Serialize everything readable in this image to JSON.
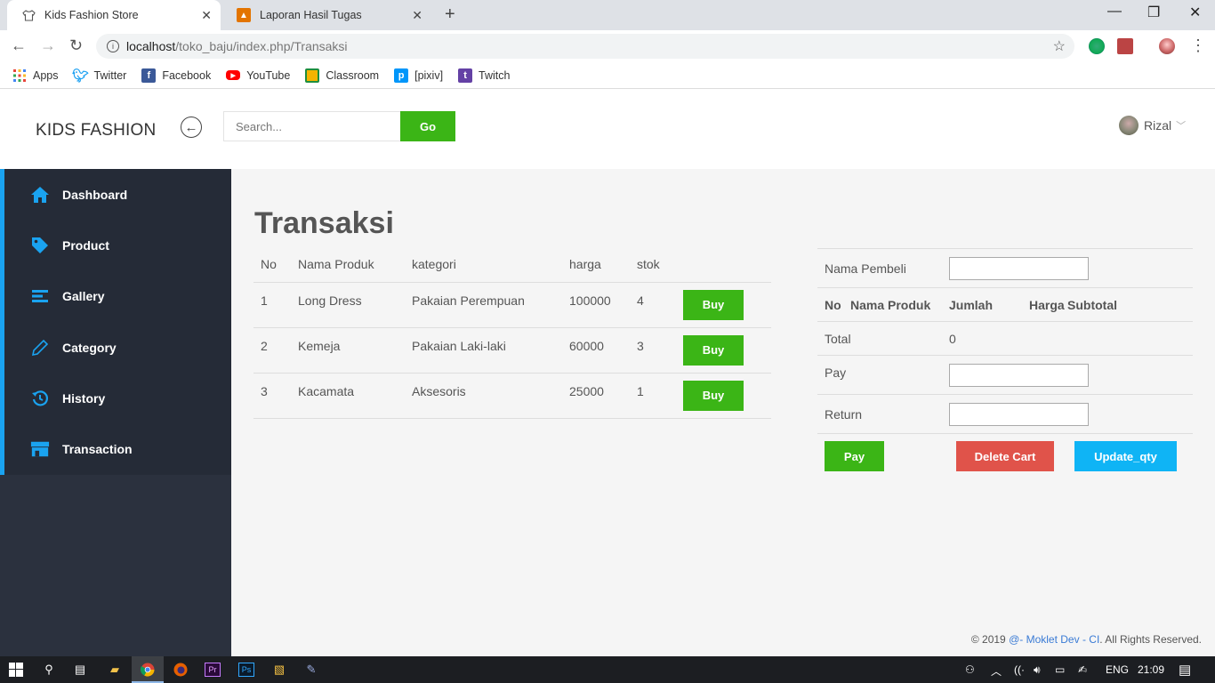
{
  "browser": {
    "tabs": [
      {
        "title": "Kids Fashion Store",
        "active": true
      },
      {
        "title": "Laporan Hasil Tugas",
        "active": false
      }
    ],
    "url_host": "localhost",
    "url_path": "/toko_baju/index.php/Transaksi",
    "bookmarks": [
      {
        "label": "Apps",
        "icon": "apps-grid-icon",
        "color": "#e8453c"
      },
      {
        "label": "Twitter",
        "icon": "twitter-icon",
        "color": "#1da1f2"
      },
      {
        "label": "Facebook",
        "icon": "facebook-icon",
        "color": "#3b5998"
      },
      {
        "label": "YouTube",
        "icon": "youtube-icon",
        "color": "#ff0000"
      },
      {
        "label": "Classroom",
        "icon": "classroom-icon",
        "color": "#f4b400"
      },
      {
        "label": "[pixiv]",
        "icon": "pixiv-icon",
        "color": "#0096fa"
      },
      {
        "label": "Twitch",
        "icon": "twitch-icon",
        "color": "#6441a5"
      }
    ]
  },
  "header": {
    "brand": "KIDS FASHION",
    "search_placeholder": "Search...",
    "go_label": "Go",
    "user_name": "Rizal"
  },
  "sidebar": {
    "accent": "#1aa3f0",
    "items": [
      {
        "label": "Dashboard",
        "icon": "home-icon"
      },
      {
        "label": "Product",
        "icon": "tag-icon"
      },
      {
        "label": "Gallery",
        "icon": "list-icon"
      },
      {
        "label": "Category",
        "icon": "pencil-icon"
      },
      {
        "label": "History",
        "icon": "history-icon"
      },
      {
        "label": "Transaction",
        "icon": "store-icon"
      }
    ]
  },
  "main": {
    "title": "Transaksi",
    "product_table": {
      "headers": [
        "No",
        "Nama Produk",
        "kategori",
        "harga",
        "stok"
      ],
      "rows": [
        {
          "no": "1",
          "name": "Long Dress",
          "category": "Pakaian Perempuan",
          "price": "100000",
          "stock": "4",
          "action": "Buy"
        },
        {
          "no": "2",
          "name": "Kemeja",
          "category": "Pakaian Laki-laki",
          "price": "60000",
          "stock": "3",
          "action": "Buy"
        },
        {
          "no": "3",
          "name": "Kacamata",
          "category": "Aksesoris",
          "price": "25000",
          "stock": "1",
          "action": "Buy"
        }
      ]
    },
    "cart": {
      "buyer_label": "Nama Pembeli",
      "headers": [
        "No",
        "Nama Produk",
        "Jumlah",
        "Harga",
        "Subtotal"
      ],
      "total_label": "Total",
      "total_value": "0",
      "pay_label": "Pay",
      "return_label": "Return",
      "buttons": {
        "pay": "Pay",
        "delete": "Delete Cart",
        "update": "Update_qty"
      }
    },
    "footer": {
      "prefix": "© 2019 ",
      "link": "@- Moklet Dev - CI",
      "suffix": ". All Rights Reserved."
    }
  },
  "taskbar": {
    "lang": "ENG",
    "time": "21:09"
  },
  "colors": {
    "green": "#3bb516",
    "red": "#e0534a",
    "blue": "#0fb4f5",
    "sidebar_bg": "#2b313e"
  }
}
